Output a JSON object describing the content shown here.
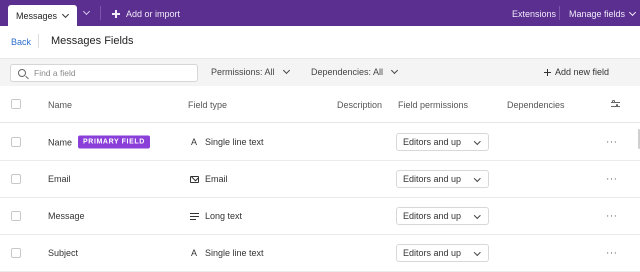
{
  "topbar": {
    "active_tab": "Messages",
    "add_import": "Add or import",
    "extensions": "Extensions",
    "manage_fields": "Manage fields"
  },
  "header": {
    "back": "Back",
    "title": "Messages Fields"
  },
  "toolbar": {
    "search_placeholder": "Find a field",
    "permissions_filter": "Permissions: All",
    "dependencies_filter": "Dependencies: All",
    "add_new_field": "Add new field"
  },
  "table": {
    "columns": {
      "name": "Name",
      "field_type": "Field type",
      "description": "Description",
      "field_permissions": "Field permissions",
      "dependencies": "Dependencies"
    },
    "rows": [
      {
        "name": "Name",
        "badge": "PRIMARY FIELD",
        "type": "Single line text",
        "type_icon": "single-line-text-icon",
        "permission": "Editors and up"
      },
      {
        "name": "Email",
        "badge": "",
        "type": "Email",
        "type_icon": "mail-icon",
        "permission": "Editors and up"
      },
      {
        "name": "Message",
        "badge": "",
        "type": "Long text",
        "type_icon": "long-text-icon",
        "permission": "Editors and up"
      },
      {
        "name": "Subject",
        "badge": "",
        "type": "Single line text",
        "type_icon": "single-line-text-icon",
        "permission": "Editors and up"
      }
    ]
  },
  "colors": {
    "topbar": "#5a2f8f",
    "badge": "#8b3fd9",
    "link": "#2f6fcf"
  }
}
